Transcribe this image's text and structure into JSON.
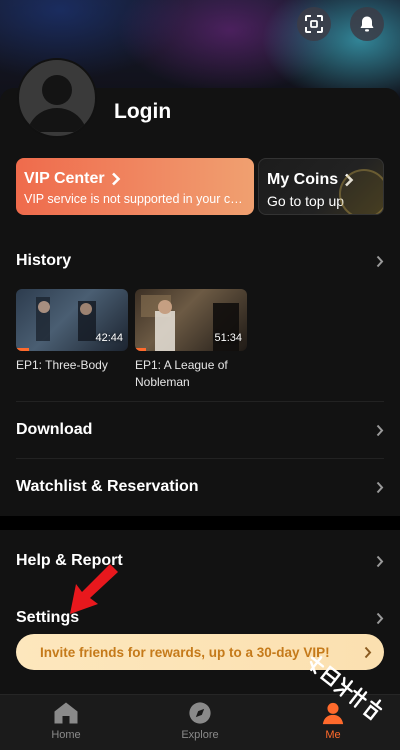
{
  "header": {
    "scan_icon": "scan-icon",
    "bell_icon": "bell-icon"
  },
  "profile": {
    "login_label": "Login"
  },
  "vip": {
    "title": "VIP Center",
    "subtitle": "VIP service is not supported in your cou..."
  },
  "coins": {
    "title": "My Coins",
    "subtitle": "Go to top up"
  },
  "history": {
    "label": "History",
    "items": [
      {
        "duration": "42:44",
        "caption": "EP1: Three-Body",
        "progress": 0.12
      },
      {
        "duration": "51:34",
        "caption": "EP1: A League of Nobleman",
        "progress": 0.1
      }
    ]
  },
  "menu": {
    "download": "Download",
    "watchlist": "Watchlist & Reservation",
    "help": "Help & Report",
    "settings": "Settings"
  },
  "banner": {
    "text": "Invite friends for rewards, up to a 30-day VIP!"
  },
  "nav": {
    "home": "Home",
    "explore": "Explore",
    "me": "Me"
  },
  "colors": {
    "accent": "#ff6a2c",
    "vip_gradient_start": "#ef6b4c",
    "banner_bg": "#fde7bd",
    "banner_text": "#c57a1a"
  }
}
